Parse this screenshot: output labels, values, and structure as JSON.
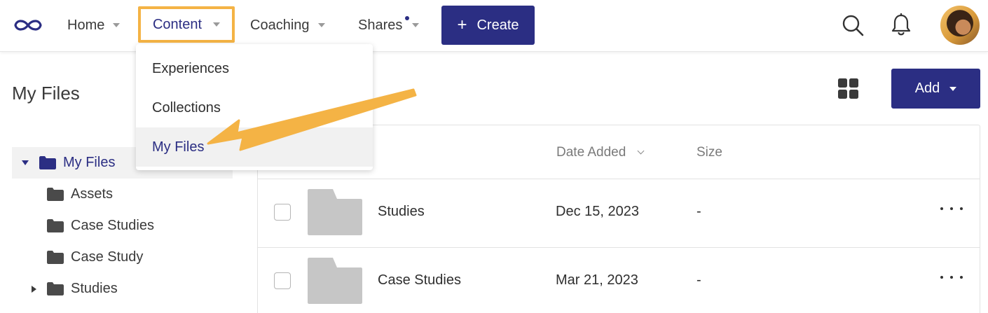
{
  "nav": {
    "home": "Home",
    "content": "Content",
    "coaching": "Coaching",
    "shares": "Shares",
    "create": "Create"
  },
  "icons": {
    "logo": "infinity-logo-icon",
    "search": "search-icon",
    "notifications": "bell-icon",
    "view_toggle": "grid-view-icon",
    "folder": "folder-icon",
    "more": "more-options-icon"
  },
  "content_menu": {
    "items": [
      "Experiences",
      "Collections",
      "My Files"
    ],
    "selected": "My Files"
  },
  "page": {
    "title": "My Files",
    "add_label": "Add"
  },
  "tree": {
    "root": "My Files",
    "children": [
      "Assets",
      "Case Studies",
      "Case Study",
      "Studies"
    ]
  },
  "table": {
    "columns": {
      "date_added": "Date Added",
      "size": "Size"
    },
    "rows": [
      {
        "name": "Studies",
        "date_added": "Dec 15, 2023",
        "size": "-"
      },
      {
        "name": "Case Studies",
        "date_added": "Mar 21, 2023",
        "size": "-"
      }
    ]
  },
  "colors": {
    "brand_navy": "#2b2e83",
    "highlight_orange": "#f4b345",
    "folder_gray": "#c6c6c6",
    "tree_folder": "#4a4a4a"
  }
}
